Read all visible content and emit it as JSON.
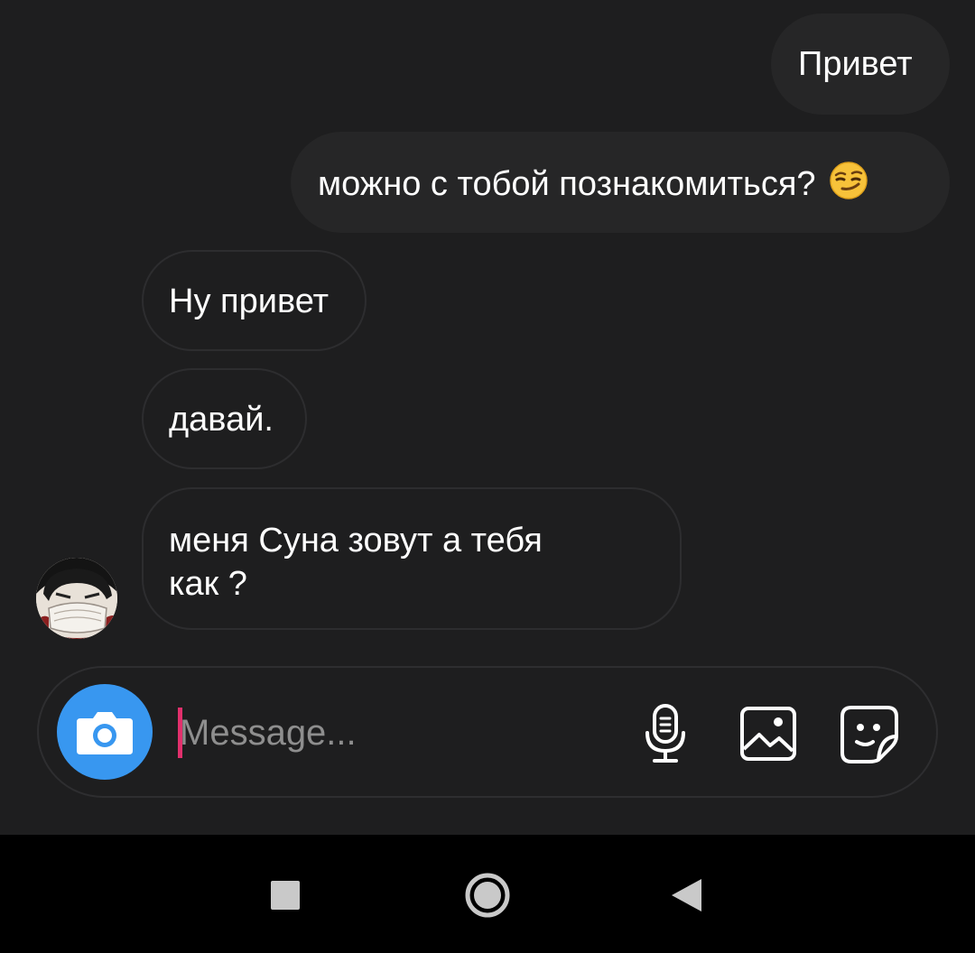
{
  "messages": {
    "sent": [
      {
        "text": "Привет"
      },
      {
        "text": "можно с тобой познакомиться?",
        "emoji": "smirking-face"
      }
    ],
    "received": [
      {
        "text": "Ну привет"
      },
      {
        "text": "давай."
      },
      {
        "line1": "меня Суна зовут а тебя",
        "line2": "как ?"
      }
    ]
  },
  "composer": {
    "placeholder": "Message...",
    "camera_icon": "camera-icon",
    "mic_icon": "microphone-icon",
    "gallery_icon": "gallery-icon",
    "sticker_icon": "sticker-icon"
  },
  "navigation": {
    "recents_icon": "recents-square-icon",
    "home_icon": "home-circle-icon",
    "back_icon": "back-triangle-icon"
  },
  "colors": {
    "background": "#1e1e1f",
    "bubble_sent": "#262627",
    "bubble_received_border": "#2d2d2f",
    "camera_button": "#3897f0",
    "caret": "#e1306c",
    "navbar": "#000000"
  }
}
